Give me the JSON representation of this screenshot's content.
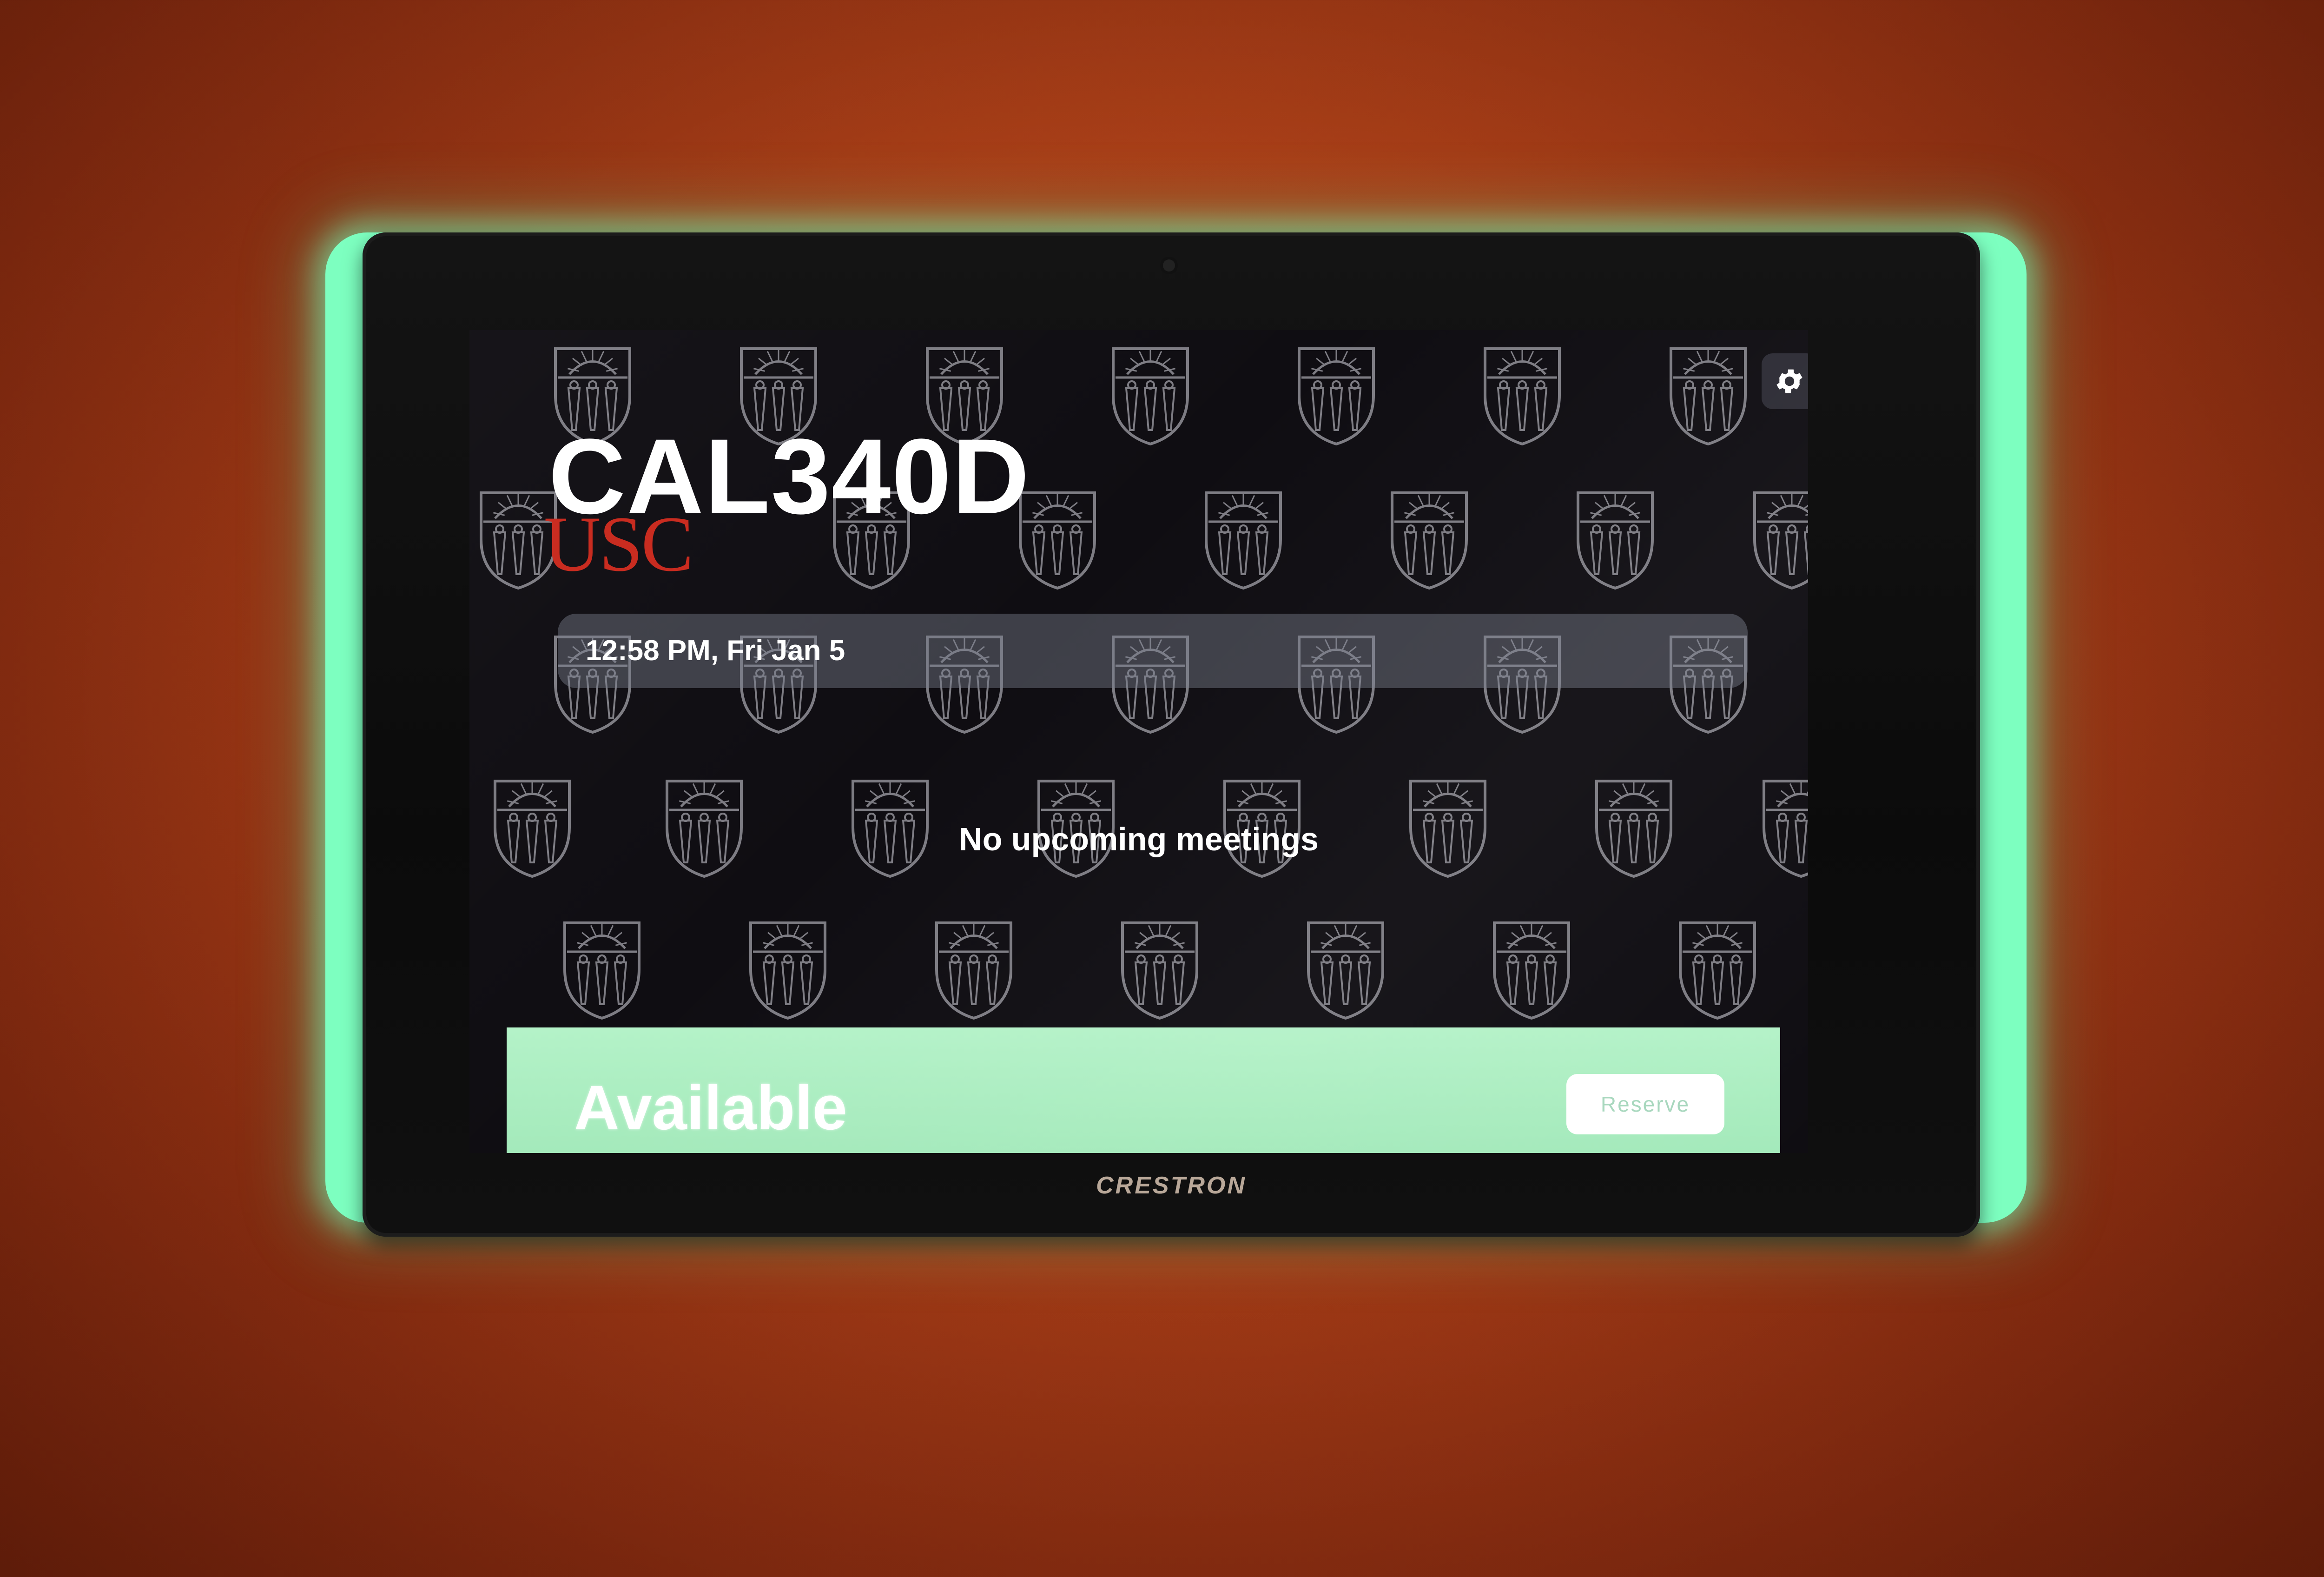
{
  "room": {
    "name": "CAL340D",
    "logo_text": "USC"
  },
  "schedule": {
    "datetime": "12:58 PM, Fri Jan 5",
    "empty_message": "No upcoming meetings"
  },
  "status": {
    "label": "Available",
    "reserve_label": "Reserve"
  },
  "device": {
    "brand": "CRESTRON"
  },
  "icons": {
    "settings": "gear-icon",
    "pattern": "shield-crest-icon"
  },
  "colors": {
    "wall": "#a63d17",
    "status_bar": "#9fe7b7",
    "led_glow": "#7dffc0",
    "logo": "#c8281c"
  }
}
